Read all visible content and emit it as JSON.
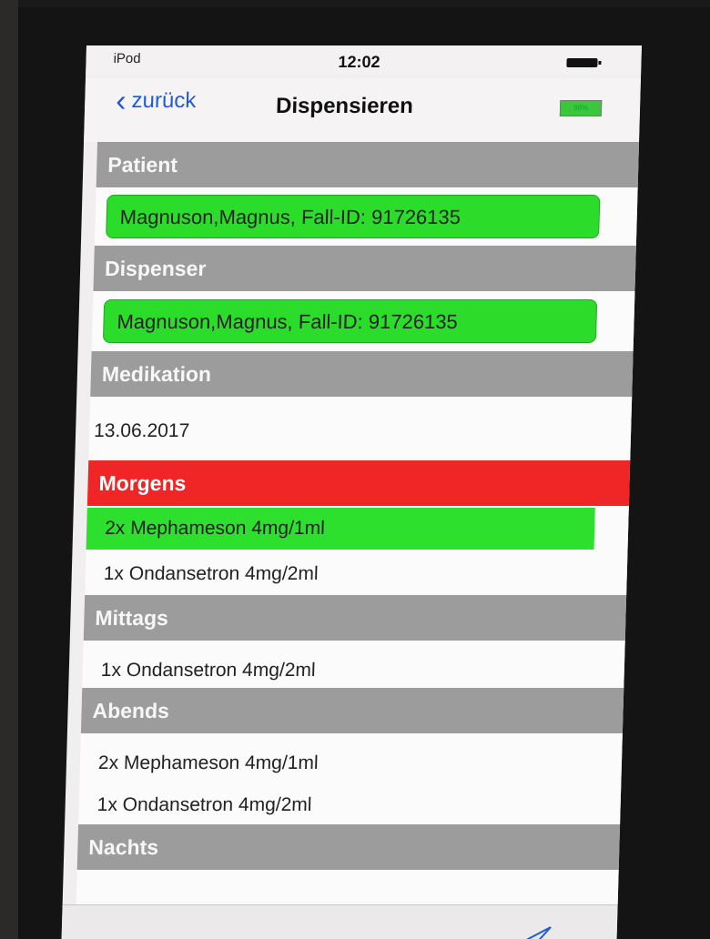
{
  "status_bar": {
    "carrier": "iPod",
    "time": "12:02"
  },
  "nav": {
    "back_label": "zurück",
    "title": "Dispensieren",
    "battery_label": "98%"
  },
  "sections": {
    "patient": {
      "header": "Patient",
      "value": "Magnuson,Magnus, Fall-ID: 91726135"
    },
    "dispenser": {
      "header": "Dispenser",
      "value": "Magnuson,Magnus, Fall-ID: 91726135"
    },
    "medikation": {
      "header": "Medikation",
      "date": "13.06.2017"
    }
  },
  "schedule": {
    "morgens": {
      "header": "Morgens",
      "items": [
        "2x Mephameson 4mg/1ml",
        "1x Ondansetron 4mg/2ml"
      ]
    },
    "mittags": {
      "header": "Mittags",
      "items": [
        "1x Ondansetron 4mg/2ml"
      ]
    },
    "abends": {
      "header": "Abends",
      "items": [
        "2x Mephameson 4mg/1ml",
        "1x Ondansetron 4mg/2ml"
      ]
    },
    "nachts": {
      "header": "Nachts",
      "items": []
    }
  },
  "colors": {
    "accent_blue": "#1f5bd6",
    "section_gray": "#9c9c9c",
    "confirmed_green": "#2bdc2b",
    "alert_red": "#f02525"
  },
  "icons": {
    "back": "chevron-left-icon",
    "send": "paper-plane-icon"
  }
}
